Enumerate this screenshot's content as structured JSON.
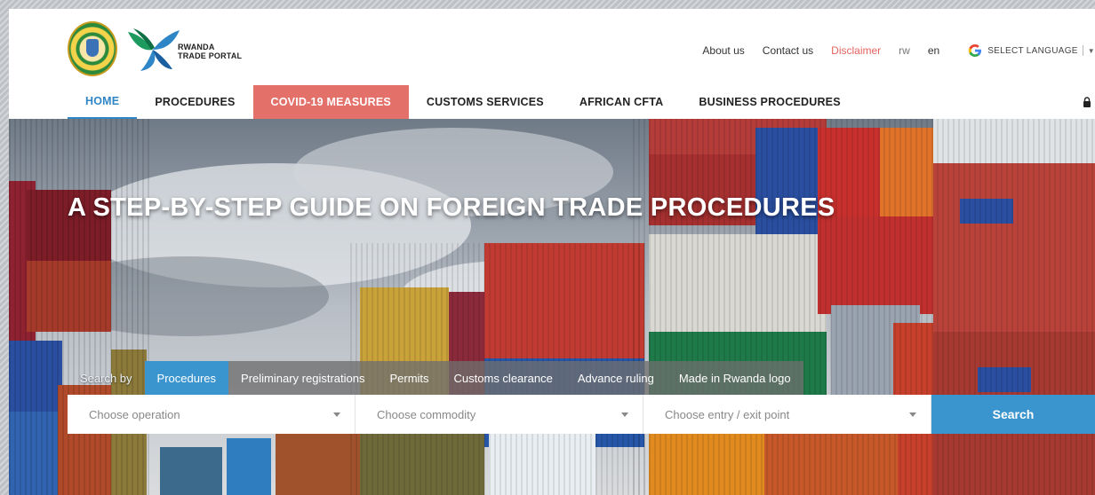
{
  "header": {
    "brand_line1": "RWANDA",
    "brand_line2": "TRADE PORTAL",
    "links": [
      "About us",
      "Contact us",
      "Disclaimer"
    ],
    "languages": [
      "rw",
      "en"
    ],
    "translate_label": "SELECT LANGUAGE"
  },
  "nav": {
    "items": [
      "HOME",
      "PROCEDURES",
      "COVID-19 MEASURES",
      "CUSTOMS SERVICES",
      "AFRICAN CFTA",
      "BUSINESS PROCEDURES"
    ],
    "active": "HOME",
    "highlight": "COVID-19 MEASURES"
  },
  "hero": {
    "title": "A STEP-BY-STEP GUIDE ON FOREIGN TRADE PROCEDURES",
    "search_by_label": "Search by",
    "tabs": [
      "Procedures",
      "Preliminary registrations",
      "Permits",
      "Customs clearance",
      "Advance ruling",
      "Made in Rwanda logo"
    ],
    "active_tab": "Procedures",
    "selects": {
      "operation_placeholder": "Choose operation",
      "commodity_placeholder": "Choose commodity",
      "point_placeholder": "Choose entry / exit point"
    },
    "search_label": "Search"
  },
  "colors": {
    "accent": "#3a95cf",
    "covid": "#e4706a",
    "disclaimer": "#e5645f"
  },
  "icons": [
    "rwanda-seal-icon",
    "trade-portal-logo-icon",
    "google-icon",
    "chevron-down-icon",
    "lock-icon"
  ]
}
